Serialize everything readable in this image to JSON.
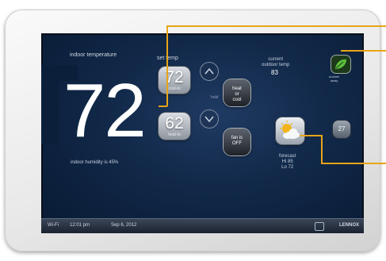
{
  "screen": {
    "indoor_label": "indoor temperature",
    "indoor_temp": "72",
    "indoor_humidity": "indoor humidity is 45%",
    "set_temp_label": "set temp",
    "cool_to": {
      "value": "72",
      "label": "cool-to"
    },
    "heat_to": {
      "value": "62",
      "label": "heat-to"
    },
    "hold_label": "hold",
    "mode_button": {
      "line1": "heat",
      "line2": "or",
      "line3": "cool"
    },
    "fan_button": {
      "line1": "fan is",
      "line2": "OFF"
    },
    "outdoor": {
      "label_line1": "current",
      "label_line2": "outdoor temp",
      "value": "83"
    },
    "forecast": {
      "label": "forecast",
      "hi": "Hi 85",
      "lo": "Lo 72"
    },
    "small_button": "27",
    "eco_label": {
      "line1": "ecobee",
      "line2": "away"
    }
  },
  "status_bar": {
    "wifi": "Wi-Fi",
    "time": "12:01 pm",
    "date": "Sep 6, 2012",
    "brand": "LENNOX"
  },
  "colors": {
    "screen_bg": "#112848",
    "callout": "#e8a517",
    "bezel": "#e9e9e9"
  },
  "icons": [
    "chevron-up-icon",
    "chevron-down-icon",
    "weather-sun-cloud-icon",
    "leaf-icon",
    "wifi-icon"
  ]
}
